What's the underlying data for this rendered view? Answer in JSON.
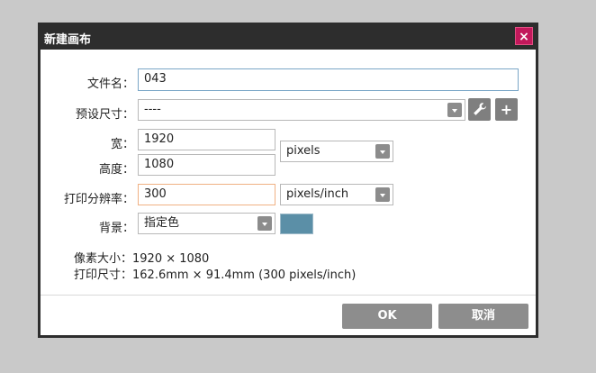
{
  "dialog": {
    "title": "新建画布",
    "close_label": "×"
  },
  "form": {
    "filename": {
      "label": "文件名：",
      "value": "043"
    },
    "preset": {
      "label": "预设尺寸：",
      "value": "----"
    },
    "width": {
      "label": "宽：",
      "value": "1920"
    },
    "height": {
      "label": "高度：",
      "value": "1080"
    },
    "unit": {
      "value": "pixels"
    },
    "resolution": {
      "label": "打印分辨率：",
      "value": "300",
      "unit": "pixels/inch"
    },
    "background": {
      "label": "背景：",
      "value": "指定色",
      "color": "#5b8fa7"
    }
  },
  "info": {
    "pixel_size": "像素大小：1920 × 1080",
    "print_size": "打印尺寸：162.6mm × 91.4mm (300 pixels/inch)"
  },
  "buttons": {
    "ok": "OK",
    "cancel": "取消"
  },
  "icons": {
    "wrench": "wrench-icon",
    "add": "plus-icon"
  }
}
